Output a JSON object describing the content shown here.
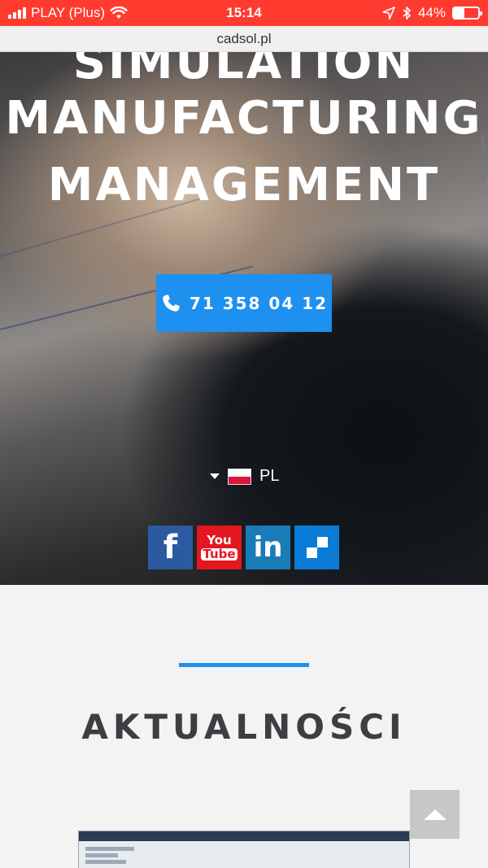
{
  "status_bar": {
    "carrier": "PLAY (Plus)",
    "time": "15:14",
    "battery": "44%",
    "battery_level": 0.44,
    "icons": [
      "signal-icon",
      "wifi-icon",
      "location-icon",
      "bluetooth-icon",
      "battery-icon"
    ]
  },
  "browser": {
    "url": "cadsol.pl"
  },
  "hero": {
    "title_lines": [
      "SIMULATION",
      "MANUFACTURING",
      "MANAGEMENT"
    ],
    "phone": "71 358 04 12",
    "phone_icon": "phone-icon",
    "language": "PL",
    "social": [
      {
        "name": "facebook",
        "label": "f",
        "color": "#2c5aa0"
      },
      {
        "name": "youtube",
        "label_top": "You",
        "label_bottom": "Tube",
        "color": "#e4161f"
      },
      {
        "name": "linkedin",
        "label": "in",
        "color": "#1a7bb9"
      },
      {
        "name": "3ds",
        "label": "",
        "color": "#0b7bd8"
      }
    ]
  },
  "news": {
    "heading": "AKTUALNOŚCI",
    "accent_color": "#1e90f0"
  },
  "colors": {
    "brand_blue": "#1e90f0",
    "status_red": "#ff3b30"
  }
}
